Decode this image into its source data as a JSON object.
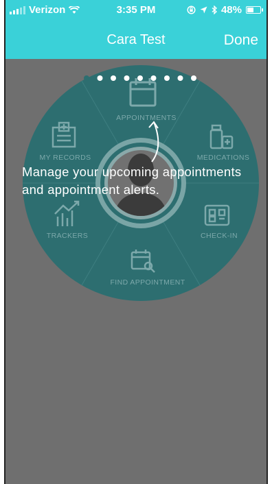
{
  "status_bar": {
    "carrier": "Verizon",
    "time": "3:35 PM",
    "battery_percent": "48%",
    "battery_level": 0.48
  },
  "nav": {
    "title": "Cara Test",
    "done_label": "Done"
  },
  "pager": {
    "total": 9,
    "active_index": 0
  },
  "wheel": {
    "items": {
      "appointments": "APPOINTMENTS",
      "medications": "MEDICATIONS",
      "check_in": "CHECK-IN",
      "find_appointment": "FIND APPOINTMENT",
      "trackers": "TRACKERS",
      "my_records": "MY RECORDS"
    }
  },
  "tutorial": {
    "message": "Manage your upcoming appointments and appointment alerts."
  },
  "colors": {
    "header": "#3ad1d8",
    "overlay": "#6f6f6f",
    "wheel": "#2d6e70",
    "wheel_label": "#7da9ab"
  }
}
